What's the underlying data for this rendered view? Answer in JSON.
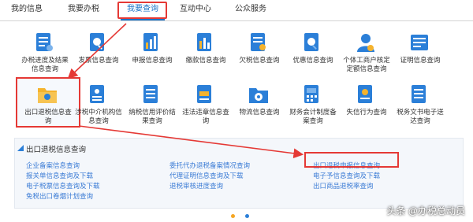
{
  "tabs": [
    {
      "label": "我的信息",
      "active": false
    },
    {
      "label": "我要办税",
      "active": false
    },
    {
      "label": "我要查询",
      "active": true
    },
    {
      "label": "互动中心",
      "active": false
    },
    {
      "label": "公众服务",
      "active": false
    }
  ],
  "grid": {
    "row1": [
      {
        "label": "办税进度及结果信息查询",
        "icon": "progress-result-icon"
      },
      {
        "label": "发票信息查询",
        "icon": "invoice-icon"
      },
      {
        "label": "申报信息查询",
        "icon": "declaration-icon"
      },
      {
        "label": "缴款信息查询",
        "icon": "payment-icon"
      },
      {
        "label": "欠税信息查询",
        "icon": "arrears-icon"
      },
      {
        "label": "优惠信息查询",
        "icon": "discount-icon"
      },
      {
        "label": "个体工商户核定定额信息查询",
        "icon": "self-employed-icon"
      },
      {
        "label": "证明信息查询",
        "icon": "certificate-icon"
      }
    ],
    "row2": [
      {
        "label": "出口退税信息查询",
        "icon": "export-refund-folder-icon"
      },
      {
        "label": "涉税中介机构信息查询",
        "icon": "tax-agency-icon"
      },
      {
        "label": "纳税信用评价结果查询",
        "icon": "credit-rating-icon"
      },
      {
        "label": "违法违章信息查询",
        "icon": "violation-icon"
      },
      {
        "label": "物流信息查询",
        "icon": "logistics-icon"
      },
      {
        "label": "财务会计制度备案查询",
        "icon": "accounting-icon"
      },
      {
        "label": "失信行为查询",
        "icon": "dishonesty-icon"
      },
      {
        "label": "税务文书电子送达查询",
        "icon": "e-document-icon"
      }
    ]
  },
  "sub_panel": {
    "title": "出口退税信息查询",
    "col1": [
      "企业备案信息查询",
      "报关单信息查询及下载",
      "电子税票信息查询及下载",
      "免税出口卷烟计划查询"
    ],
    "col2": [
      "委托代办退税备案情况查询",
      "代理证明信息查询及下载",
      "退税审核进度查询"
    ],
    "col3": [
      "出口退税申报信息查询",
      "电子予信息查询及下载",
      "出口商品退税率查询"
    ]
  },
  "watermark": "头条 @办税总动员",
  "colors": {
    "accent": "#1a73c7",
    "link": "#3a7bd5",
    "highlight": "#e53935"
  }
}
